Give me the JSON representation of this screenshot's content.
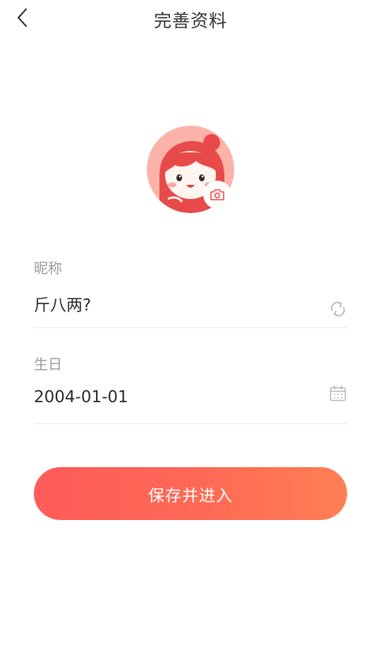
{
  "header": {
    "title": "完善资料",
    "back_icon": "chevron-left-icon"
  },
  "avatar": {
    "image": "cartoon-girl-red-hood-avatar",
    "badge_icon": "camera-icon",
    "accent_color": "#f25a5a"
  },
  "form": {
    "nickname": {
      "label": "昵称",
      "value": "斤八两?",
      "icon": "refresh-icon"
    },
    "birthday": {
      "label": "生日",
      "value": "2004-01-01",
      "icon": "calendar-icon"
    }
  },
  "actions": {
    "save_label": "保存并进入",
    "gradient_start": "#fe5b58",
    "gradient_end": "#ff7f55"
  }
}
